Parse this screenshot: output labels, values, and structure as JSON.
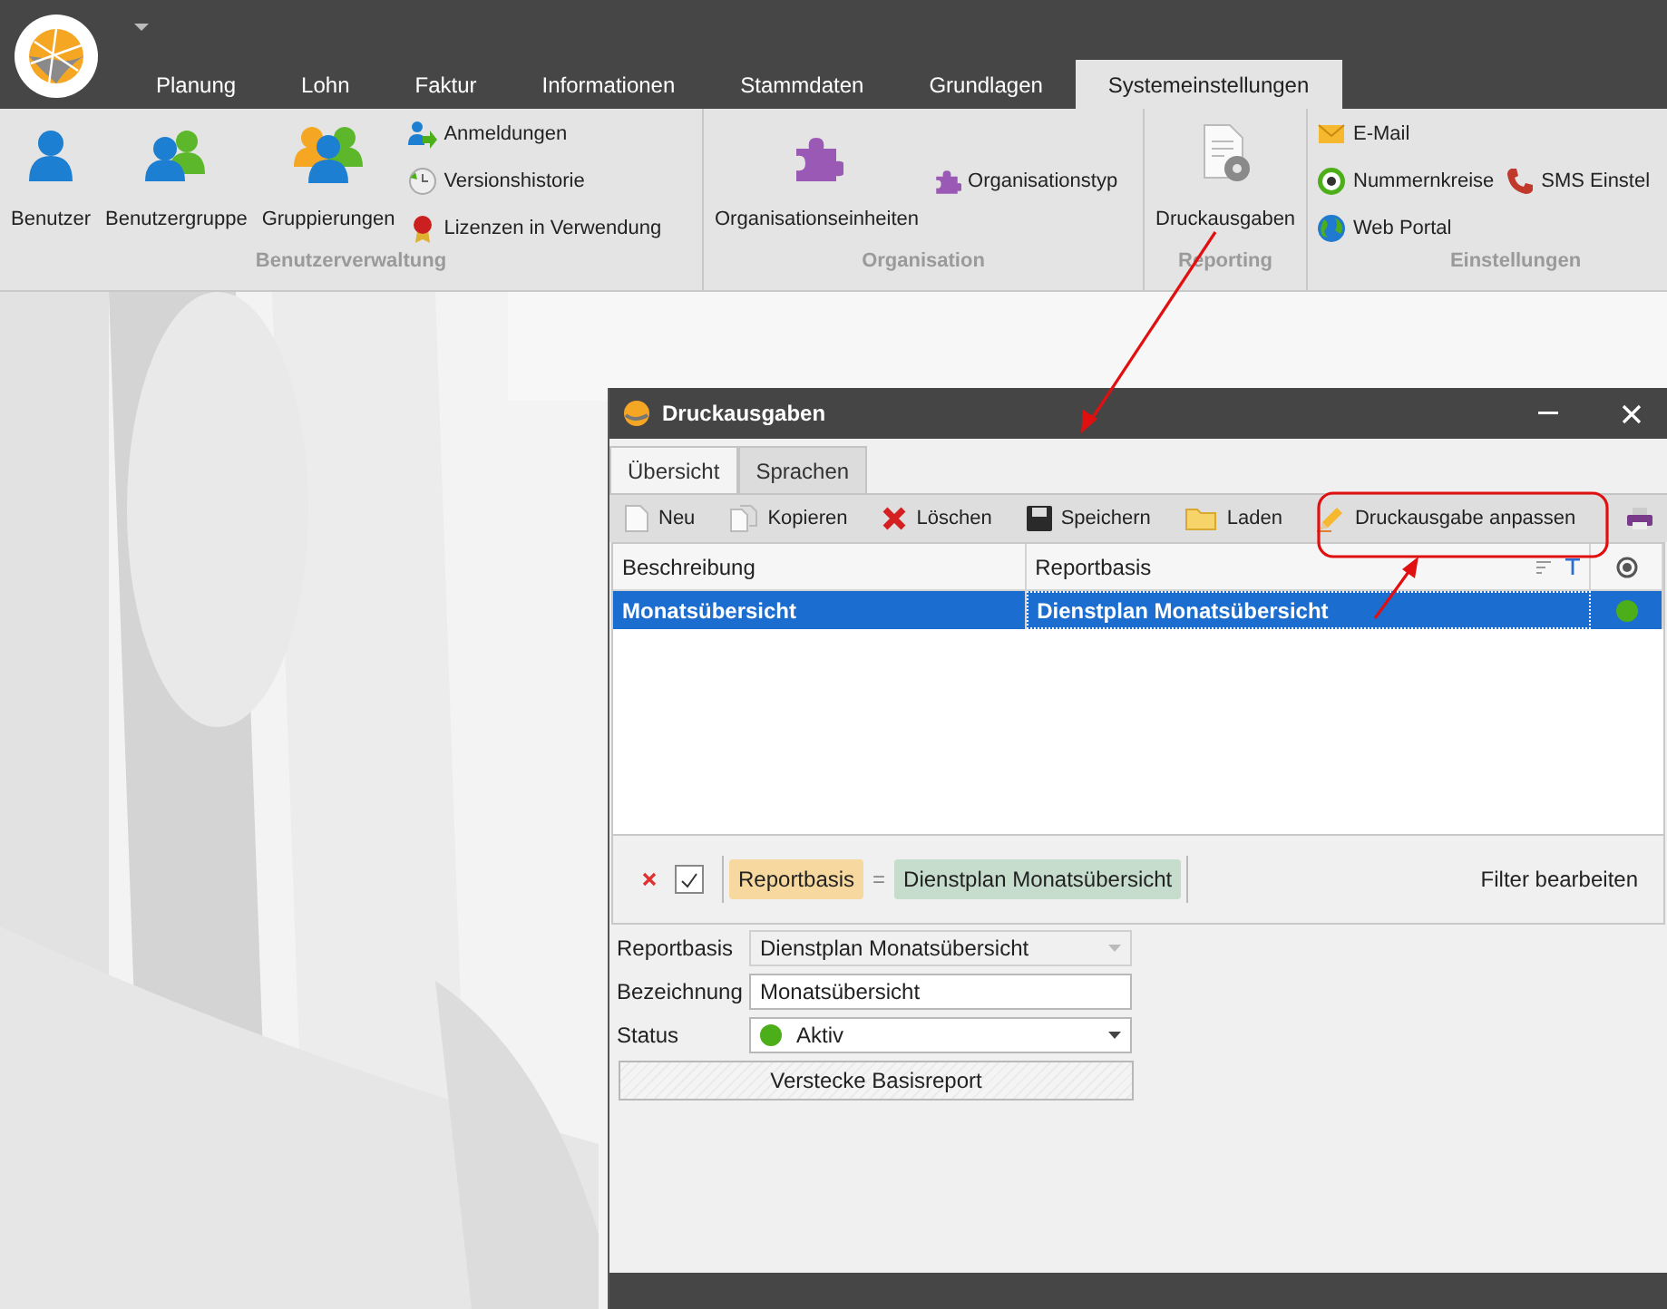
{
  "main_tabs": [
    {
      "label": "Planung",
      "selected": false
    },
    {
      "label": "Lohn",
      "selected": false
    },
    {
      "label": "Faktur",
      "selected": false
    },
    {
      "label": "Informationen",
      "selected": false
    },
    {
      "label": "Stammdaten",
      "selected": false
    },
    {
      "label": "Grundlagen",
      "selected": false
    },
    {
      "label": "Systemeinstellungen",
      "selected": true
    }
  ],
  "ribbon_groups": [
    {
      "title": "Benutzerverwaltung",
      "large_buttons": [
        "Benutzer",
        "Benutzergruppe",
        "Gruppierungen"
      ],
      "small_columns": [
        [
          "Anmeldungen",
          "Versionshistorie",
          "Lizenzen in Verwendung"
        ]
      ]
    },
    {
      "title": "Organisation",
      "large_buttons": [
        "Organisationseinheiten"
      ],
      "small_columns": [
        [
          "Organisationstyp"
        ]
      ]
    },
    {
      "title": "Reporting",
      "large_buttons": [
        "Druckausgaben"
      ]
    },
    {
      "title": "Einstellungen",
      "small_columns": [
        [
          "E-Mail",
          "Nummernkreise",
          "Web Portal"
        ],
        [
          "SMS Einstel"
        ]
      ]
    }
  ],
  "dialog": {
    "title": "Druckausgaben",
    "tabs": [
      {
        "label": "Übersicht",
        "selected": true
      },
      {
        "label": "Sprachen",
        "selected": false
      }
    ],
    "toolbar": [
      "Neu",
      "Kopieren",
      "Löschen",
      "Speichern",
      "Laden",
      "Druckausgabe anpassen"
    ],
    "grid": {
      "columns": [
        "Beschreibung",
        "Reportbasis"
      ],
      "rows": [
        {
          "cells": [
            "Monatsübersicht",
            "Dienstplan Monatsübersicht"
          ],
          "selected": true,
          "color": "#4caf1a"
        }
      ]
    },
    "filter": {
      "checked": true,
      "field": "Reportbasis",
      "operator": "=",
      "value": "Dienstplan Monatsübersicht",
      "edit_label": "Filter bearbeiten"
    },
    "form": [
      {
        "label": "Reportbasis",
        "kind": "combo",
        "value": "Dienstplan Monatsübersicht",
        "disabled": true
      },
      {
        "label": "Bezeichnung",
        "kind": "text",
        "value": "Monatsübersicht",
        "disabled": false
      },
      {
        "label": "Status",
        "kind": "status",
        "value": "Aktiv",
        "color": "#4caf1a",
        "disabled": false
      }
    ],
    "button": "Verstecke Basisreport"
  }
}
